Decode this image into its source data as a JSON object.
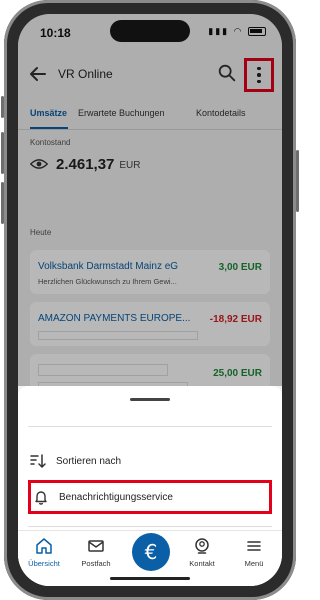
{
  "status": {
    "time": "10:18"
  },
  "appbar": {
    "title": "VR Online"
  },
  "tabs": [
    {
      "label": "Umsätze",
      "active": true
    },
    {
      "label": "Erwartete Buchungen",
      "active": false
    },
    {
      "label": "Kontodetails",
      "active": false
    }
  ],
  "account": {
    "balance_label": "Kontostand",
    "balance": "2.461,37",
    "currency": "EUR"
  },
  "section": {
    "label": "Heute"
  },
  "transactions": [
    {
      "name": "Volksbank Darmstadt Mainz eG",
      "subtitle": "Herzlichen Glückwunsch zu Ihrem Gewi...",
      "amount": "3,00 EUR",
      "sign": "positive"
    },
    {
      "name": "AMAZON PAYMENTS EUROPE...",
      "subtitle": "",
      "amount": "-18,92 EUR",
      "sign": "negative"
    },
    {
      "name": "",
      "subtitle": "",
      "amount": "25,00 EUR",
      "sign": "positive"
    }
  ],
  "sheet": {
    "items": [
      {
        "label": "Sortieren nach",
        "icon": "sort-icon"
      },
      {
        "label": "Benachrichtigungsservice",
        "icon": "bell-icon"
      }
    ]
  },
  "nav": {
    "items": [
      {
        "label": "Übersicht",
        "icon": "home-icon",
        "active": true
      },
      {
        "label": "Postfach",
        "icon": "mail-icon",
        "active": false
      },
      {
        "label": "Kontakt",
        "icon": "contact-icon",
        "active": false
      },
      {
        "label": "Menü",
        "icon": "menu-icon",
        "active": false
      }
    ],
    "center_symbol": "€"
  },
  "colors": {
    "accent": "#0a5fa6",
    "positive": "#1f8a3a",
    "negative": "#d31f26",
    "highlight": "#e3001b"
  }
}
